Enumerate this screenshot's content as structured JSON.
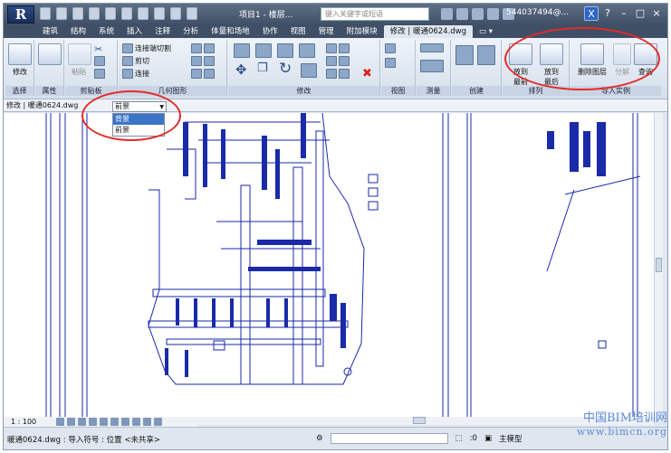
{
  "app": {
    "title": "项目1 - 楼层...",
    "search_placeholder": "键入关键字或短语",
    "user": "544037494@...",
    "help": "?"
  },
  "tabs": [
    "建筑",
    "结构",
    "系统",
    "插入",
    "注释",
    "分析",
    "体量和场地",
    "协作",
    "视图",
    "管理",
    "附加模块",
    "修改 | 暖通0624.dwg"
  ],
  "active_tab": "修改 | 暖通0624.dwg",
  "ribbon": {
    "modify_label": "修改",
    "properties_label": "属性",
    "panels": {
      "select": "选择",
      "properties": "属性",
      "clipboard": "剪贴板",
      "geometry": "几何图形",
      "modify": "修改",
      "view": "视图",
      "measure": "测量",
      "create": "创建",
      "arrange": "排列",
      "import_instance": "导入实例"
    },
    "clipboard": {
      "paste": "粘贴"
    },
    "geometry": {
      "cut_join": "连接端切割",
      "cut": "剪切",
      "join": "连接"
    },
    "arrange": {
      "bring_front": "放到\n最前",
      "send_back": "放到\n最后"
    },
    "import_instance": {
      "delete_layers": "删除图层",
      "explode": "分解",
      "query": "查询"
    }
  },
  "options_bar": {
    "context_label": "修改 | 暖通0624.dwg",
    "dropdown_value": "前景",
    "dropdown_options": [
      "背景",
      "前景"
    ],
    "dropdown_selected": "背景"
  },
  "view_control": {
    "scale": "1 : 100"
  },
  "status_bar": {
    "text": "暖通0624.dwg : 导入符号 : 位置 <未共享>",
    "worksets": ":0",
    "model": "主模型"
  },
  "watermark": {
    "line1": "中国BIM培训网",
    "line2": "www.bimcn.org"
  },
  "colors": {
    "annotation": "#e52a2a",
    "drawing": "#1a2aa8",
    "selection": "#3b75c7"
  }
}
